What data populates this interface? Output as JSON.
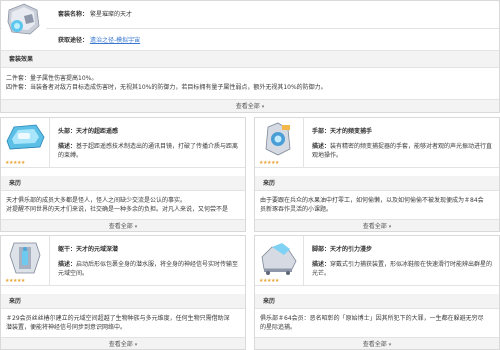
{
  "set": {
    "name_label": "套装名称：",
    "name_value": "繁星璀璨的天才",
    "source_label": "获取途径：",
    "source_link": "遗治之径-模拟宇宙",
    "effects_header": "套装效果",
    "effect_2pc": "二件套：量子属性伤害提高10%。",
    "effect_4pc": "四件套：当装备者对敌方目标造成伤害时，无视其10%的防御力，若目标拥有量子属性弱点，额外无视其10%的防御力。",
    "view_all": "查看全部"
  },
  "pieces": [
    {
      "slot_name": "头部：天才的超距遥感",
      "desc_label": "描述：",
      "desc": "基于超距遥感技术制造出的通讯目镜，打破了传播介质与距离的束缚。",
      "history_header": "来历",
      "history_l1": "天才俱乐部的成员大多都是怪人，怪人之间缺少交流是公认的事实。",
      "history_l2": "对提醒不同世界的天才们来说，社交确是一种多余的负担。对凡人来说，又何尝不是",
      "view_all": "查看全部",
      "stars": "★★★★★"
    },
    {
      "slot_name": "手部：天才的频变捕手",
      "desc_label": "描述：",
      "desc": "装有精密的频变捕捉器的手套，能够对者观的声光振动进行直观地操作。",
      "history_header": "来历",
      "history_l1": "由于要跟在兵众的水果油中打零工，如何偷懒，以及如何偷偷不被发现便成为＃84会",
      "history_l2": "员新琢吞作灵活的小课题。",
      "view_all": "查看全部",
      "stars": "★★★★★"
    },
    {
      "slot_name": "躯干：天才的元域深潜",
      "desc_label": "描述：",
      "desc": "启动后形似包裹全身的潜水服，将全身的神经信号实时传输至元域空间。",
      "history_header": "来历",
      "history_l1": "＃29会员丝丝椿尔建立的元域空间超越了生物种族与多元维度，任何生物只需借助深",
      "history_l2": "潜装置，便能将神经信号同步到意识网络中。",
      "view_all": "查看全部",
      "stars": "★★★★★"
    },
    {
      "slot_name": "脚部：天才的引力漫步",
      "desc_label": "描述：",
      "desc": "穿戴式引力捕获装置，形似冰鞋般在快速滑行时能辨出群星的光芒。",
      "history_header": "来历",
      "history_l1": "俱乐部＃64会员：恶名昭彰的「原始博士」因其所犯下的大罪，一生都在躲避无穷尽",
      "history_l2": "的星际追捕。",
      "view_all": "查看全部",
      "stars": "★★★★★"
    }
  ],
  "icons": [
    "set-icon",
    "head-piece-icon",
    "hands-piece-icon",
    "body-piece-icon",
    "feet-piece-icon",
    "chevron-down-icon"
  ],
  "colors": {
    "star": "#e9a53b",
    "link": "#3a78d2",
    "border": "#d9d9d9",
    "header_bg": "#f3f3f3"
  }
}
